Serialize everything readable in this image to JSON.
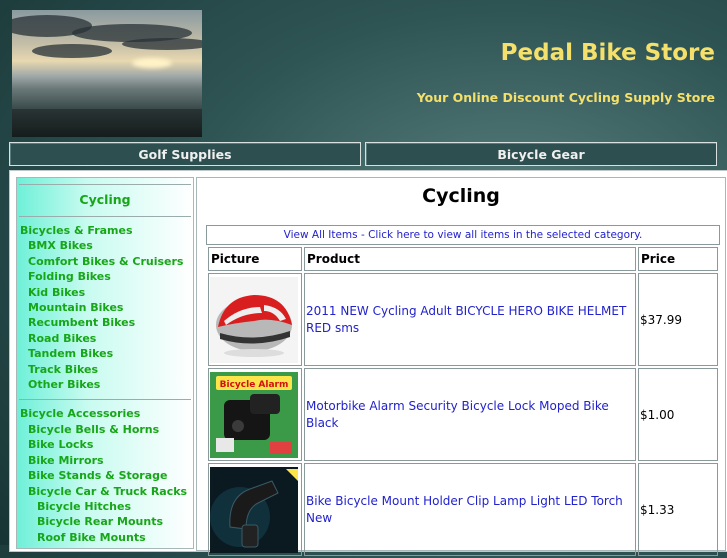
{
  "site": {
    "title": "Pedal Bike Store",
    "tagline": "Your Online Discount Cycling Supply Store"
  },
  "nav": [
    "Golf Supplies",
    "Bicycle Gear"
  ],
  "sidebar": {
    "title": "Cycling",
    "groups": [
      {
        "items": [
          {
            "label": "Bicycles & Frames",
            "level": 0
          },
          {
            "label": "BMX Bikes",
            "level": 1
          },
          {
            "label": "Comfort Bikes & Cruisers",
            "level": 1
          },
          {
            "label": "Folding Bikes",
            "level": 1
          },
          {
            "label": "Kid Bikes",
            "level": 1
          },
          {
            "label": "Mountain Bikes",
            "level": 1
          },
          {
            "label": "Recumbent Bikes",
            "level": 1
          },
          {
            "label": "Road Bikes",
            "level": 1
          },
          {
            "label": "Tandem Bikes",
            "level": 1
          },
          {
            "label": "Track Bikes",
            "level": 1
          },
          {
            "label": "Other Bikes",
            "level": 1
          }
        ]
      },
      {
        "items": [
          {
            "label": "Bicycle Accessories",
            "level": 0
          },
          {
            "label": "Bicycle Bells & Horns",
            "level": 1
          },
          {
            "label": "Bike Locks",
            "level": 1
          },
          {
            "label": "Bike Mirrors",
            "level": 1
          },
          {
            "label": "Bike Stands & Storage",
            "level": 1
          },
          {
            "label": "Bicycle Car & Truck Racks",
            "level": 1
          },
          {
            "label": "Bicycle Hitches",
            "level": 2
          },
          {
            "label": "Bicycle Rear Mounts",
            "level": 2
          },
          {
            "label": "Roof Bike Mounts",
            "level": 2
          }
        ]
      }
    ]
  },
  "main": {
    "title": "Cycling",
    "view_all": "View All Items - Click here to view all items in the selected category.",
    "columns": [
      "Picture",
      "Product",
      "Price"
    ],
    "products": [
      {
        "image": "bike-helmet-image",
        "name": "2011 NEW Cycling Adult BICYCLE HERO BIKE HELMET RED sms",
        "price": "$37.99"
      },
      {
        "image": "bicycle-alarm-image",
        "image_text": "Bicycle Alarm",
        "name": "Motorbike Alarm Security Bicycle Lock Moped Bike Black",
        "price": "$1.00"
      },
      {
        "image": "lamp-mount-image",
        "name": "Bike Bicycle Mount Holder Clip Lamp Light LED Torch New",
        "price": "$1.33"
      }
    ]
  },
  "colors": {
    "title_yellow": "#f4e06a",
    "link_green": "#17a617",
    "link_blue": "#2222cc",
    "nav_bg": "#2d4f4f"
  }
}
